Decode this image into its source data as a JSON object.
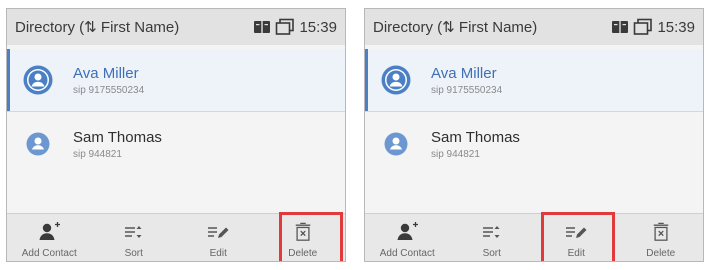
{
  "screens": [
    {
      "status": {
        "title": "Directory (⇅ First Name)",
        "time": "15:39"
      },
      "contacts": [
        {
          "name": "Ava Miller",
          "sip": "sip 9175550234"
        },
        {
          "name": "Sam Thomas",
          "sip": "sip 944821"
        }
      ],
      "softkeys": [
        {
          "label": "Add Contact",
          "icon": "add-contact-icon"
        },
        {
          "label": "Sort",
          "icon": "sort-icon"
        },
        {
          "label": "Edit",
          "icon": "edit-icon"
        },
        {
          "label": "Delete",
          "icon": "delete-icon"
        }
      ],
      "highlighted_softkey": "Delete"
    },
    {
      "status": {
        "title": "Directory (⇅ First Name)",
        "time": "15:39"
      },
      "contacts": [
        {
          "name": "Ava Miller",
          "sip": "sip 9175550234"
        },
        {
          "name": "Sam Thomas",
          "sip": "sip 944821"
        }
      ],
      "softkeys": [
        {
          "label": "Add Contact",
          "icon": "add-contact-icon"
        },
        {
          "label": "Sort",
          "icon": "sort-icon"
        },
        {
          "label": "Edit",
          "icon": "edit-icon"
        },
        {
          "label": "Delete",
          "icon": "delete-icon"
        }
      ],
      "highlighted_softkey": "Edit"
    }
  ],
  "colors": {
    "accent": "#4b80c4",
    "highlight": "#e03a3a",
    "status_bar": "#e2e2e2"
  }
}
